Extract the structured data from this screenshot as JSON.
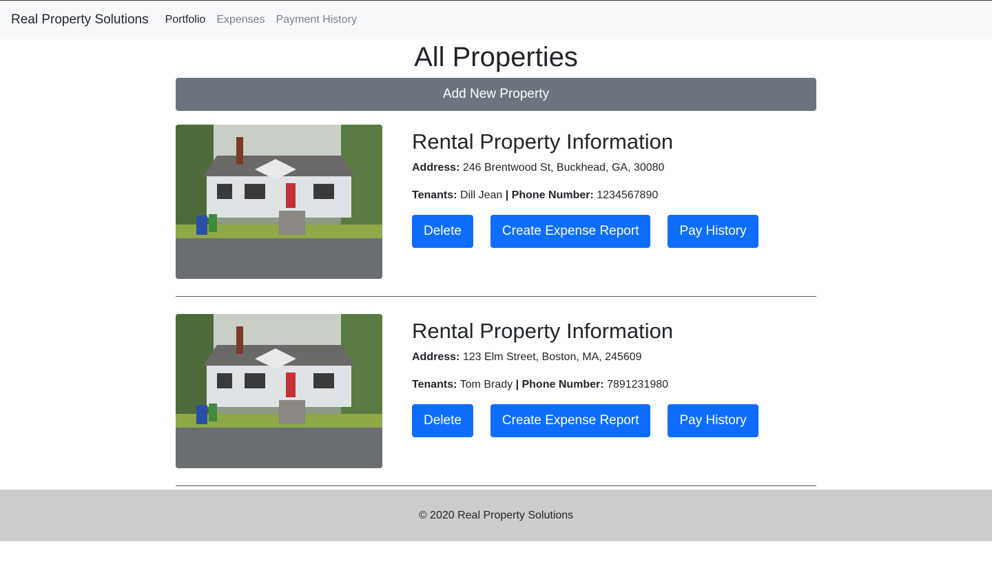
{
  "navbar": {
    "brand": "Real Property Solutions",
    "links": [
      "Portfolio",
      "Expenses",
      "Payment History"
    ],
    "active": "Portfolio"
  },
  "main": {
    "title": "All Properties",
    "add_button": "Add New Property"
  },
  "labels": {
    "address": "Address:",
    "tenants": "Tenants:",
    "phone": "| Phone Number:"
  },
  "properties": [
    {
      "heading": "Rental Property Information",
      "address": "246 Brentwood St, Buckhead, GA, 30080",
      "tenants": "Dill Jean",
      "phone": "1234567890",
      "buttons": [
        "Delete",
        "Create Expense Report",
        "Pay History"
      ]
    },
    {
      "heading": "Rental Property Information",
      "address": "123 Elm Street, Boston, MA, 245609",
      "tenants": "Tom Brady",
      "phone": "7891231980",
      "buttons": [
        "Delete",
        "Create Expense Report",
        "Pay History"
      ]
    }
  ],
  "footer": {
    "text": "© 2020 Real Property Solutions"
  },
  "colors": {
    "primary": "#0d6efd",
    "secondary": "#6c757d",
    "footer_bg": "#cccccc",
    "navbar_bg": "#f8f9fa"
  }
}
